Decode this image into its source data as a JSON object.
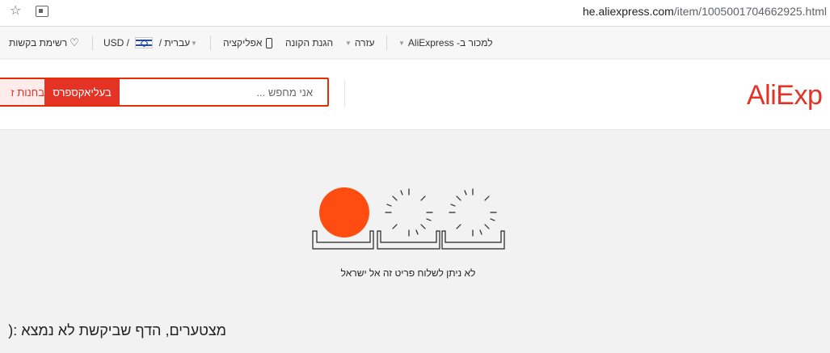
{
  "browser": {
    "url_host": "he.aliexpress.com",
    "url_path": "/item/1005001704662925.html",
    "icons": [
      "star-icon",
      "translate-icon"
    ]
  },
  "util_bar": {
    "wishlist": "רשימת בקשות",
    "currency": "USD",
    "language": "עברית",
    "app": "אפליקציה",
    "buyer_protection": "הגנת הקונה",
    "help": "עזרה",
    "sell_on": "למכור ב- AliExpress"
  },
  "header": {
    "logo": "AliExp",
    "search_placeholder": "אני מחפש ...",
    "search_aliexpress": "בעליאקספרס",
    "search_store": "בחנות ז"
  },
  "main": {
    "message": "לא ניתן לשלוח פריט זה אל ישראל",
    "sorry": "מצטערים, הדף שביקשת לא נמצא :("
  },
  "colors": {
    "accent": "#e43225",
    "sun": "#ff4d12",
    "background": "#f2f2f2"
  }
}
